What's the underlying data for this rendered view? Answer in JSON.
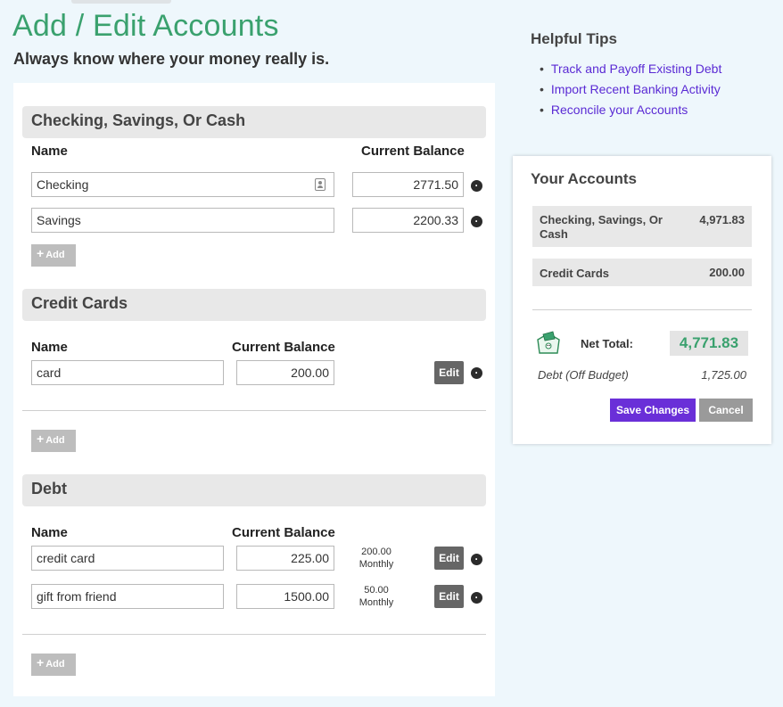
{
  "page": {
    "title": "Add / Edit Accounts",
    "subtitle": "Always know where your money really is."
  },
  "sections": {
    "checking": {
      "title": "Checking, Savings, Or Cash",
      "col_name": "Name",
      "col_balance": "Current Balance",
      "rows": [
        {
          "name": "Checking",
          "balance": "2771.50"
        },
        {
          "name": "Savings",
          "balance": "2200.33"
        }
      ],
      "add_label": "Add"
    },
    "credit": {
      "title": "Credit Cards",
      "col_name": "Name",
      "col_balance": "Current Balance",
      "rows": [
        {
          "name": "card",
          "balance": "200.00",
          "edit_label": "Edit"
        }
      ],
      "add_label": "Add"
    },
    "debt": {
      "title": "Debt",
      "col_name": "Name",
      "col_balance": "Current Balance",
      "rows": [
        {
          "name": "credit card",
          "balance": "225.00",
          "payment_amount": "200.00",
          "payment_freq": "Monthly",
          "edit_label": "Edit"
        },
        {
          "name": "gift from friend",
          "balance": "1500.00",
          "payment_amount": "50.00",
          "payment_freq": "Monthly",
          "edit_label": "Edit"
        }
      ],
      "add_label": "Add"
    }
  },
  "tips": {
    "title": "Helpful Tips",
    "items": [
      "Track and Payoff Existing Debt",
      "Import Recent Banking Activity",
      "Reconcile your Accounts"
    ]
  },
  "summary": {
    "title": "Your Accounts",
    "rows": [
      {
        "label": "Checking, Savings, Or Cash",
        "value": "4,971.83"
      },
      {
        "label": "Credit Cards",
        "value": "200.00"
      }
    ],
    "net_total_label": "Net Total:",
    "net_total_value": "4,771.83",
    "debt_label": "Debt (Off Budget)",
    "debt_value": "1,725.00",
    "save_label": "Save Changes",
    "cancel_label": "Cancel"
  },
  "colors": {
    "accent_green": "#3aa16e",
    "link_purple": "#5a2ad4",
    "save_purple": "#6a2fd8",
    "background": "#eef7fc"
  }
}
